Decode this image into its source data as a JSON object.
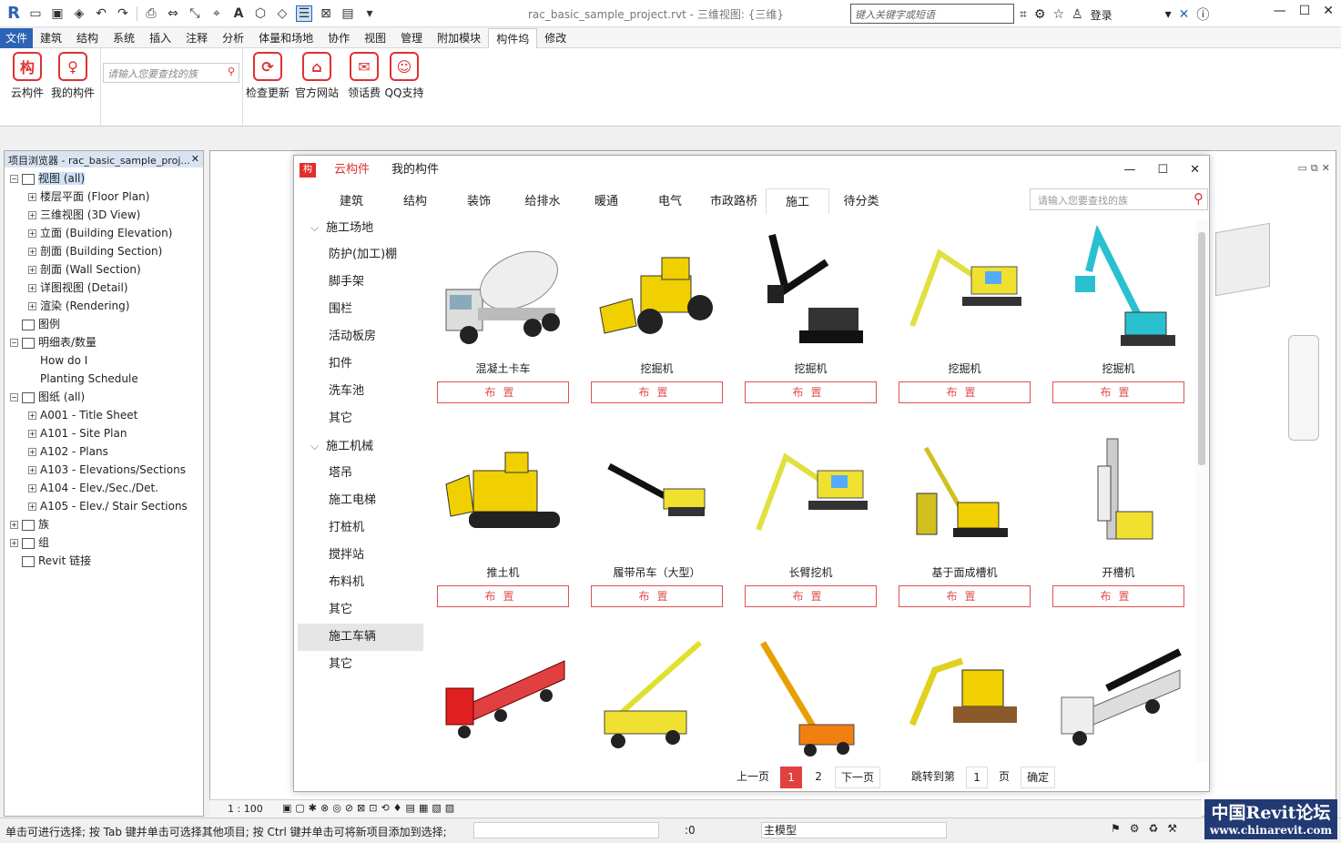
{
  "app": {
    "title": "rac_basic_sample_project.rvt - 三维视图: {三维}",
    "keyword_placeholder": "键入关键字或短语",
    "login": "登录"
  },
  "menu": {
    "file": "文件",
    "items": [
      "建筑",
      "结构",
      "系统",
      "插入",
      "注释",
      "分析",
      "体量和场地",
      "协作",
      "视图",
      "管理",
      "附加模块",
      "构件坞",
      "修改"
    ],
    "active": "构件坞"
  },
  "ribbon": {
    "buttons_left": [
      {
        "label": "云构件",
        "icon": "构"
      },
      {
        "label": "我的构件",
        "icon": "♀"
      }
    ],
    "search_placeholder": "请输入您要查找的族",
    "buttons_right": [
      {
        "label": "检查更新",
        "icon": "⟳"
      },
      {
        "label": "官方网站",
        "icon": "⌂"
      },
      {
        "label": "领话费",
        "icon": "✉"
      },
      {
        "label": "QQ支持",
        "icon": "☺"
      }
    ]
  },
  "browser": {
    "title": "项目浏览器 - rac_basic_sample_proj...",
    "nodes": [
      {
        "label": "视图 (all)",
        "depth": 0,
        "toggle": "−",
        "icon": true,
        "sel": true
      },
      {
        "label": "楼层平面 (Floor Plan)",
        "depth": 1,
        "toggle": "+"
      },
      {
        "label": "三维视图 (3D View)",
        "depth": 1,
        "toggle": "+"
      },
      {
        "label": "立面 (Building Elevation)",
        "depth": 1,
        "toggle": "+"
      },
      {
        "label": "剖面 (Building Section)",
        "depth": 1,
        "toggle": "+"
      },
      {
        "label": "剖面 (Wall Section)",
        "depth": 1,
        "toggle": "+"
      },
      {
        "label": "详图视图 (Detail)",
        "depth": 1,
        "toggle": "+"
      },
      {
        "label": "渲染 (Rendering)",
        "depth": 1,
        "toggle": "+"
      },
      {
        "label": "图例",
        "depth": 0,
        "toggle": "",
        "icon": true
      },
      {
        "label": "明细表/数量",
        "depth": 0,
        "toggle": "−",
        "icon": true
      },
      {
        "label": "How do I",
        "depth": 1,
        "toggle": ""
      },
      {
        "label": "Planting Schedule",
        "depth": 1,
        "toggle": ""
      },
      {
        "label": "图纸 (all)",
        "depth": 0,
        "toggle": "−",
        "icon": true
      },
      {
        "label": "A001 - Title Sheet",
        "depth": 1,
        "toggle": "+"
      },
      {
        "label": "A101 - Site Plan",
        "depth": 1,
        "toggle": "+"
      },
      {
        "label": "A102 - Plans",
        "depth": 1,
        "toggle": "+"
      },
      {
        "label": "A103 - Elevations/Sections",
        "depth": 1,
        "toggle": "+"
      },
      {
        "label": "A104 - Elev./Sec./Det.",
        "depth": 1,
        "toggle": "+"
      },
      {
        "label": "A105 - Elev./ Stair Sections",
        "depth": 1,
        "toggle": "+"
      },
      {
        "label": "族",
        "depth": 0,
        "toggle": "+",
        "icon": true
      },
      {
        "label": "组",
        "depth": 0,
        "toggle": "+",
        "icon": true
      },
      {
        "label": "Revit 链接",
        "depth": 0,
        "toggle": "",
        "icon": true
      }
    ]
  },
  "dialog": {
    "tabs": [
      "云构件",
      "我的构件"
    ],
    "categories": [
      "建筑",
      "结构",
      "装饰",
      "给排水",
      "暖通",
      "电气",
      "市政路桥",
      "施工",
      "待分类"
    ],
    "active_category": "施工",
    "search_placeholder": "请输入您要查找的族",
    "sidebar": [
      {
        "label": "施工场地",
        "grp": true
      },
      {
        "label": "防护(加工)棚"
      },
      {
        "label": "脚手架"
      },
      {
        "label": "围栏"
      },
      {
        "label": "活动板房"
      },
      {
        "label": "扣件"
      },
      {
        "label": "洗车池"
      },
      {
        "label": "其它"
      },
      {
        "label": "施工机械",
        "grp": true
      },
      {
        "label": "塔吊"
      },
      {
        "label": "施工电梯"
      },
      {
        "label": "打桩机"
      },
      {
        "label": "搅拌站"
      },
      {
        "label": "布料机"
      },
      {
        "label": "其它"
      },
      {
        "label": "施工车辆",
        "sel": true,
        "top": true
      },
      {
        "label": "其它",
        "top": true
      }
    ],
    "place_label": "布置",
    "items": [
      {
        "name": "混凝土卡车",
        "kind": "mixer"
      },
      {
        "name": "挖掘机",
        "kind": "loader"
      },
      {
        "name": "挖掘机",
        "kind": "excavator-black"
      },
      {
        "name": "挖掘机",
        "kind": "excavator-long"
      },
      {
        "name": "挖掘机",
        "kind": "excavator-cyan"
      },
      {
        "name": "推土机",
        "kind": "dozer"
      },
      {
        "name": "履带吊车（大型）",
        "kind": "crawler"
      },
      {
        "name": "长臂挖机",
        "kind": "excavator-long"
      },
      {
        "name": "基于面成槽机",
        "kind": "trench"
      },
      {
        "name": "开槽机",
        "kind": "slotter"
      },
      {
        "name": "",
        "kind": "truck-red"
      },
      {
        "name": "",
        "kind": "crane-yellow"
      },
      {
        "name": "",
        "kind": "crane-orange"
      },
      {
        "name": "",
        "kind": "excavator-yellow"
      },
      {
        "name": "",
        "kind": "truck-white"
      }
    ],
    "pager": {
      "prev": "上一页",
      "pages": [
        "1",
        "2"
      ],
      "current": "1",
      "next": "下一页",
      "jump": "跳转到第",
      "jump_value": "1",
      "page_unit": "页",
      "confirm": "确定"
    }
  },
  "viewbar": {
    "scale": "1 : 100"
  },
  "status": {
    "hint": "单击可进行选择; 按 Tab 键并单击可选择其他项目; 按 Ctrl 键并单击可将新项目添加到选择;",
    "count": ":0",
    "model": "主模型"
  },
  "brand": {
    "line1": "中国Revit论坛",
    "line2": "www.chinarevit.com"
  }
}
